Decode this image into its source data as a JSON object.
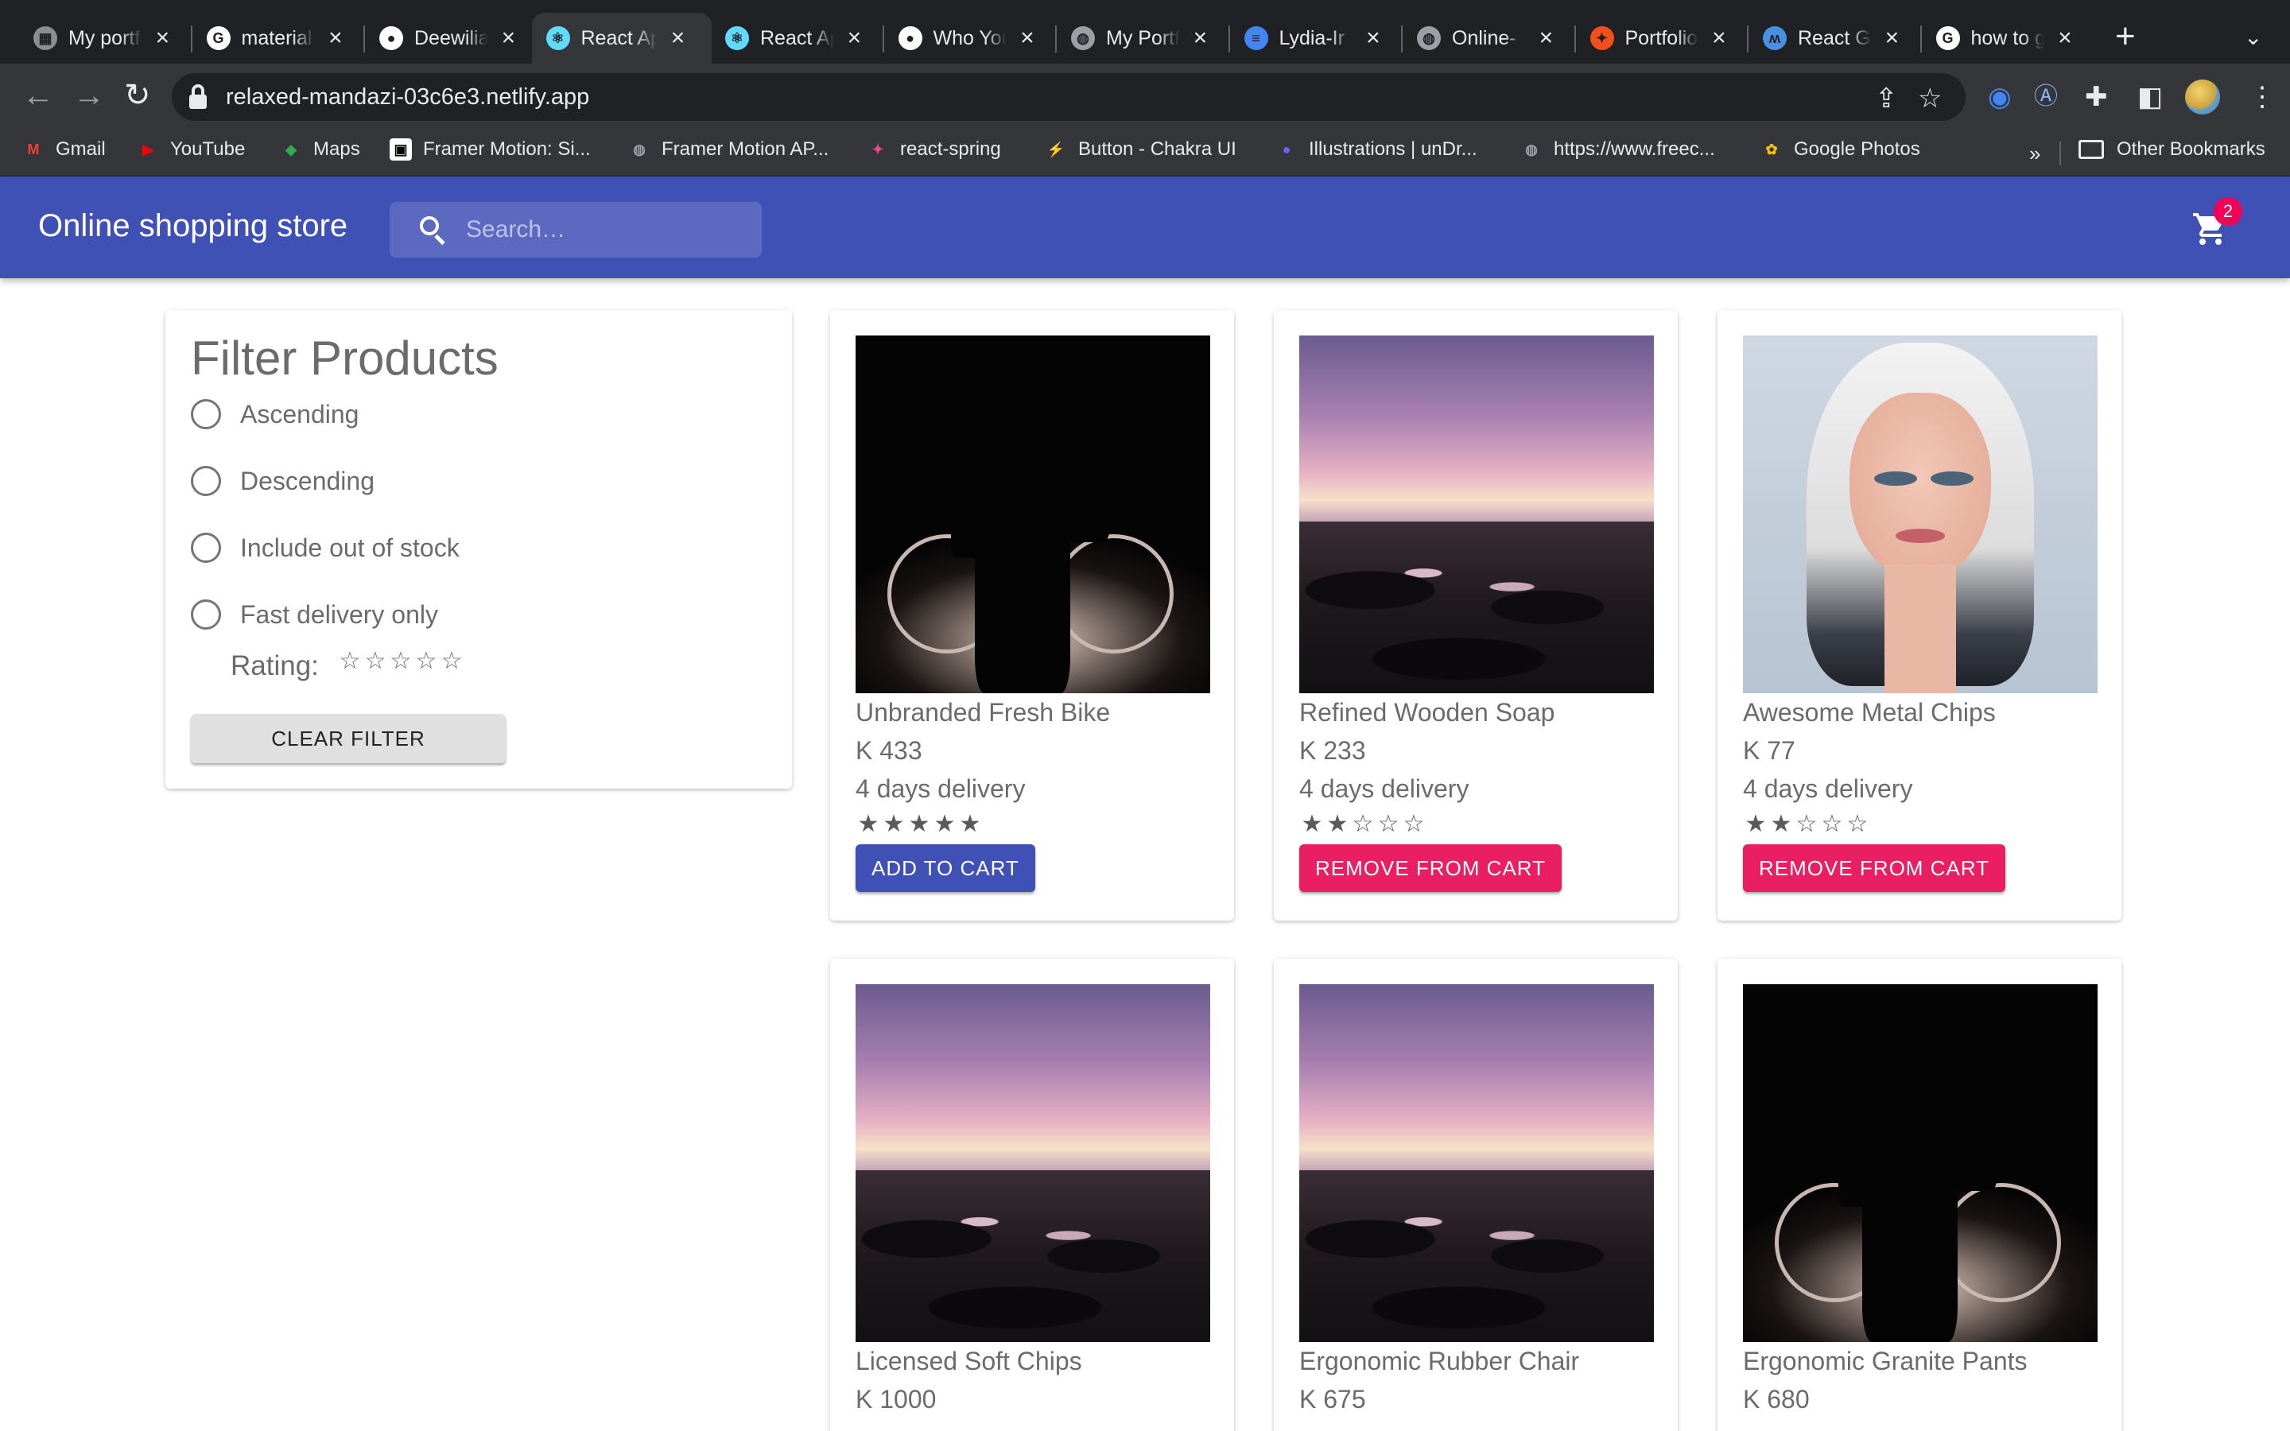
{
  "browser": {
    "tabs": [
      {
        "title": "My portfolio",
        "active": false
      },
      {
        "title": "material ui",
        "active": false
      },
      {
        "title": "Deewilia",
        "active": false
      },
      {
        "title": "React App",
        "active": true
      },
      {
        "title": "React App",
        "active": false
      },
      {
        "title": "Who You",
        "active": false
      },
      {
        "title": "My Portfolio",
        "active": false
      },
      {
        "title": "Lydia-Ir",
        "active": false
      },
      {
        "title": "Online-",
        "active": false
      },
      {
        "title": "Portfolio",
        "active": false
      },
      {
        "title": "React G",
        "active": false
      },
      {
        "title": "how to g",
        "active": false
      }
    ],
    "url": "relaxed-mandazi-03c6e3.netlify.app",
    "bookmarks": [
      {
        "label": "Gmail",
        "color": "#ea4335",
        "icon": "M"
      },
      {
        "label": "YouTube",
        "color": "#ff0000",
        "icon": "▶"
      },
      {
        "label": "Maps",
        "color": "#34a853",
        "icon": "◆"
      },
      {
        "label": "Framer Motion: Si...",
        "color": "#000000",
        "icon": "▣"
      },
      {
        "label": "Framer Motion AP...",
        "color": "#9aa0a6",
        "icon": "◍"
      },
      {
        "label": "react-spring",
        "color": "#e44b8d",
        "icon": "✦"
      },
      {
        "label": "Button - Chakra UI",
        "color": "#3cc8c8",
        "icon": "⚡"
      },
      {
        "label": "Illustrations | unDr...",
        "color": "#6c63ff",
        "icon": "●"
      },
      {
        "label": "https://www.freec...",
        "color": "#9aa0a6",
        "icon": "◍"
      },
      {
        "label": "Google Photos",
        "color": "#fbbc04",
        "icon": "✿"
      }
    ],
    "other_bookmarks": "Other Bookmarks",
    "more": "»"
  },
  "appbar": {
    "title": "Online shopping store",
    "search_placeholder": "Search…",
    "cart_count": "2"
  },
  "filter": {
    "title": "Filter Products",
    "options": [
      "Ascending",
      "Descending",
      "Include out of stock",
      "Fast delivery only"
    ],
    "rating_label": "Rating:",
    "rating_value": 0,
    "clear_label": "CLEAR FILTER"
  },
  "products": [
    {
      "name": "Unbranded Fresh Bike",
      "price": "K 433",
      "delivery": "4 days delivery",
      "rating": 5,
      "action": "ADD TO CART",
      "in_cart": false,
      "image": "bike"
    },
    {
      "name": "Refined Wooden Soap",
      "price": "K 233",
      "delivery": "4 days delivery",
      "rating": 2,
      "action": "REMOVE FROM CART",
      "in_cart": true,
      "image": "sunset"
    },
    {
      "name": "Awesome Metal Chips",
      "price": "K 77",
      "delivery": "4 days delivery",
      "rating": 2,
      "action": "REMOVE FROM CART",
      "in_cart": true,
      "image": "face"
    },
    {
      "name": "Licensed Soft Chips",
      "price": "K 1000",
      "image": "sunset"
    },
    {
      "name": "Ergonomic Rubber Chair",
      "price": "K 675",
      "image": "sunset"
    },
    {
      "name": "Ergonomic Granite Pants",
      "price": "K 680",
      "image": "bike"
    }
  ],
  "colors": {
    "primary": "#3f51b5",
    "secondary": "#e91e63",
    "badge": "#f50057"
  }
}
